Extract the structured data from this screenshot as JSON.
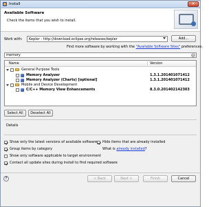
{
  "window": {
    "title": "Install",
    "close_glyph": "✕"
  },
  "header": {
    "title": "Available Software",
    "description": "Check the items that you wish to install."
  },
  "work_with": {
    "label": "Work with:",
    "value": "Kepler - http://download.eclipse.org/releases/kepler",
    "add_label": "Add...",
    "hint_prefix": "Find more software by working with the",
    "hint_link": "\"Available Software Sites\"",
    "hint_suffix": "preferences."
  },
  "filter": {
    "value": "memory"
  },
  "tree": {
    "columns": [
      "Name",
      "Version"
    ],
    "rows": [
      {
        "name": "General Purpose Tools",
        "version": ""
      },
      {
        "name": "Memory Analyzer",
        "version": "1.3.1.201401071412"
      },
      {
        "name": "Memory Analyzer (Charts) [optional]",
        "version": "1.3.1.201401071412"
      },
      {
        "name": "Mobile and Device Development",
        "version": ""
      },
      {
        "name": "C/C++ Memory View Enhancements",
        "version": "8.3.0.201402142303"
      }
    ]
  },
  "buttons": {
    "select_all": "Select All",
    "deselect_all": "Deselect All",
    "back": "< Back",
    "next": "Next >",
    "finish": "Finish",
    "cancel": "Cancel"
  },
  "details": {
    "label": "Details"
  },
  "options": {
    "latest_versions": "Show only the latest versions of available software",
    "group_by_category": "Group items by category",
    "applicable_only": "Show only software applicable to target environment",
    "contact_sites": "Contact all update sites during install to find required software",
    "hide_installed": "Hide items that are already installed",
    "what_installed_prefix": "What is",
    "what_installed_link": "already installed",
    "what_installed_suffix": "?"
  },
  "help": {
    "glyph": "?"
  }
}
